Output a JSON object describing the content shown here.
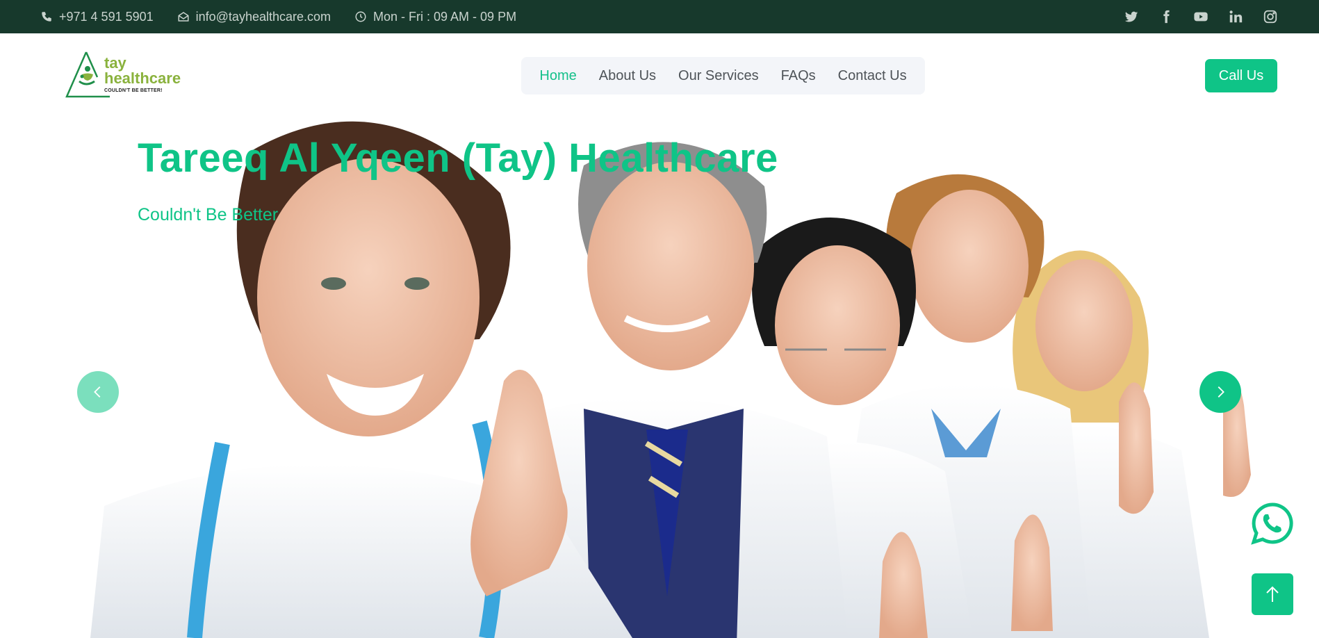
{
  "topbar": {
    "phone": "+971 4 591 5901",
    "email": "info@tayhealthcare.com",
    "hours": "Mon - Fri : 09 AM - 09 PM",
    "social_icons": [
      "twitter-icon",
      "facebook-icon",
      "youtube-icon",
      "linkedin-icon",
      "instagram-icon"
    ]
  },
  "logo": {
    "line1": "tay",
    "line2": "healthcare",
    "tagline": "COULDN'T BE BETTER!"
  },
  "nav": {
    "items": [
      {
        "label": "Home",
        "active": true
      },
      {
        "label": "About Us",
        "active": false
      },
      {
        "label": "Our Services",
        "active": false
      },
      {
        "label": "FAQs",
        "active": false
      },
      {
        "label": "Contact Us",
        "active": false
      }
    ]
  },
  "header": {
    "call_label": "Call Us"
  },
  "hero": {
    "title": "Tareeq Al Yqeen (Tay) Healthcare",
    "subtitle": "Couldn't Be Better"
  },
  "floating": {
    "whatsapp_icon": "whatsapp-icon",
    "back_to_top_icon": "arrow-up-icon"
  },
  "colors": {
    "accent": "#0fc487",
    "topbar_bg": "#17392c",
    "logo_green": "#8ab23d",
    "nav_text": "#4e5358"
  }
}
